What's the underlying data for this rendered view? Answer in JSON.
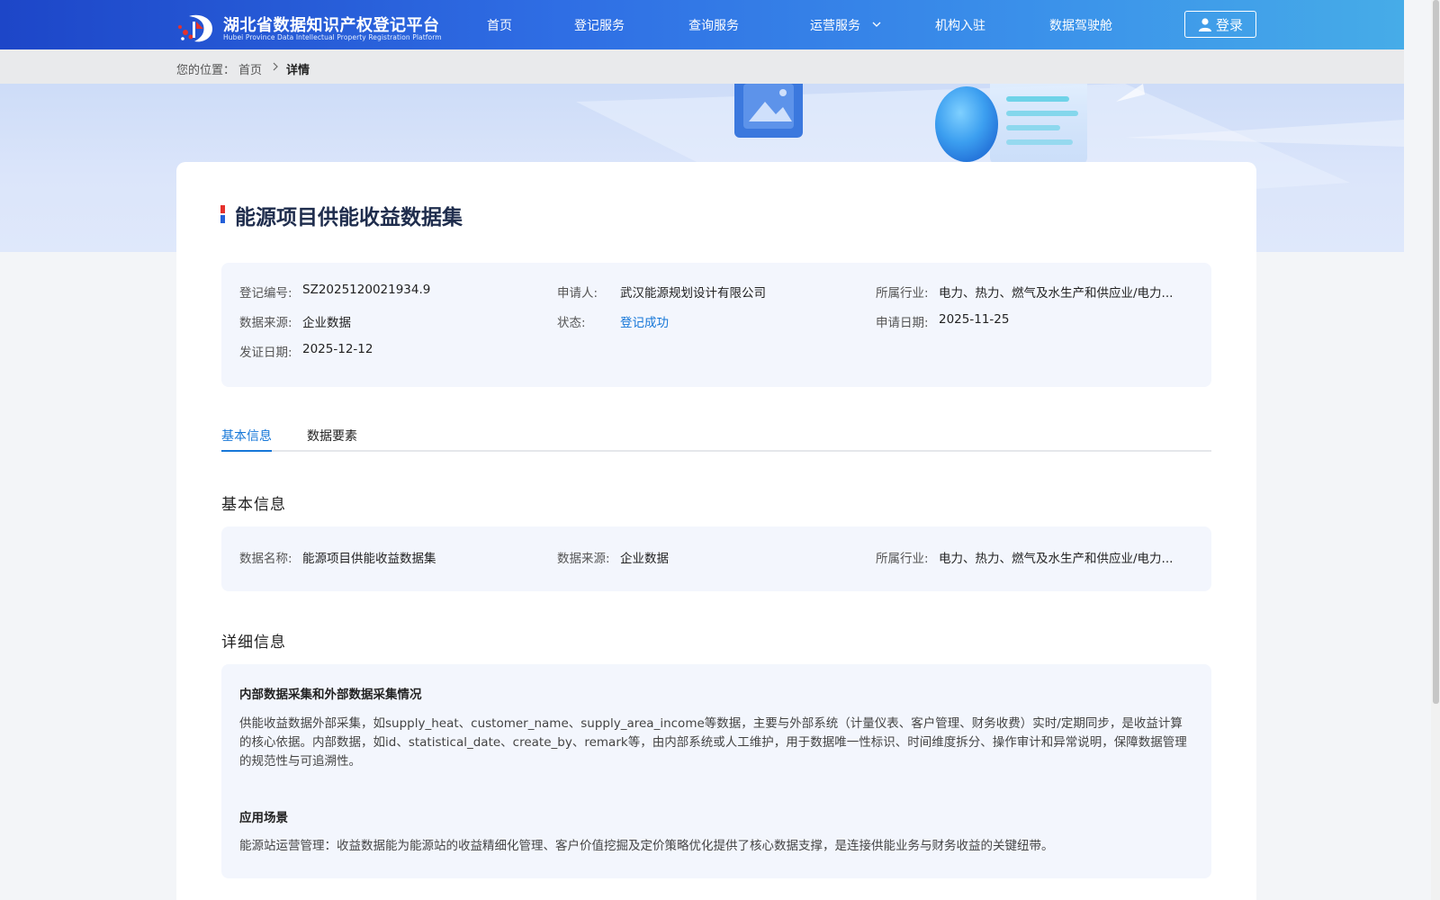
{
  "header": {
    "logo_title": "湖北省数据知识产权登记平台",
    "logo_subtitle": "Hubei Province Data Intellectual Property Registration Platform",
    "nav": [
      "首页",
      "登记服务",
      "查询服务",
      "运营服务",
      "机构入驻",
      "数据驾驶舱"
    ],
    "login_label": "登录"
  },
  "breadcrumb": {
    "prefix": "您的位置：",
    "home": "首页",
    "current": "详情"
  },
  "page": {
    "title": "能源项目供能收益数据集"
  },
  "summary": {
    "reg_no_label": "登记编号:",
    "reg_no": "SZ2025120021934.9",
    "applicant_label": "申请人:",
    "applicant": "武汉能源规划设计有限公司",
    "industry_label": "所属行业:",
    "industry": "电力、热力、燃气及水生产和供应业/电力...",
    "source_label": "数据来源:",
    "source": "企业数据",
    "status_label": "状态:",
    "status": "登记成功",
    "apply_date_label": "申请日期:",
    "apply_date": "2025-11-25",
    "issue_date_label": "发证日期:",
    "issue_date": "2025-12-12"
  },
  "tabs": [
    "基本信息",
    "数据要素"
  ],
  "basic": {
    "section_title": "基本信息",
    "name_label": "数据名称:",
    "name": "能源项目供能收益数据集",
    "source_label": "数据来源:",
    "source": "企业数据",
    "industry_label": "所属行业:",
    "industry": "电力、热力、燃气及水生产和供应业/电力..."
  },
  "detail": {
    "section_title": "详细信息",
    "collect_heading": "内部数据采集和外部数据采集情况",
    "collect_text": "供能收益数据外部采集，如supply_heat、customer_name、supply_area_income等数据，主要与外部系统（计量仪表、客户管理、财务收费）实时/定期同步，是收益计算的核心依据。内部数据，如id、statistical_date、create_by、remark等，由内部系统或人工维护，用于数据唯一性标识、时间维度拆分、操作审计和异常说明，保障数据管理的规范性与可追溯性。",
    "scenario_heading": "应用场景",
    "scenario_text": "能源站运营管理：收益数据能为能源站的收益精细化管理、客户价值挖掘及定价策略优化提供了核心数据支撑，是连接供能业务与财务收益的关键纽带。"
  },
  "colors": {
    "nav_start": "#1d46c8",
    "nav_end": "#46ace8",
    "accent": "#1677d8",
    "panel_bg": "#f3f6fd"
  },
  "icons": [
    "logo-mark-icon",
    "chevron-down-icon",
    "user-icon",
    "chevron-right-icon",
    "title-marker-icon"
  ]
}
